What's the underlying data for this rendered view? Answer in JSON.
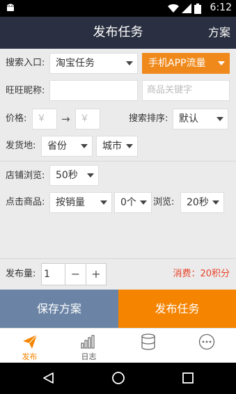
{
  "status_bar": {
    "time": "6:12"
  },
  "header": {
    "title": "发布任务",
    "action": "方案"
  },
  "form": {
    "search_entry_label": "搜索入口:",
    "search_entry_value": "淘宝任务",
    "traffic_type_value": "手机APP流量",
    "wangwang_label": "旺旺昵称:",
    "wangwang_value": "",
    "keyword_placeholder": "商品关键字",
    "price_label": "价格:",
    "price_min_placeholder": "￥",
    "price_arrow": "→",
    "price_max_placeholder": "￥",
    "sort_label": "搜索排序:",
    "sort_value": "默认",
    "ship_from_label": "发货地:",
    "province_value": "省份",
    "city_value": "城市",
    "shop_browse_label": "店铺浏览:",
    "shop_browse_value": "50秒",
    "click_goods_label": "点击商品:",
    "click_goods_value": "按销量",
    "click_count_value": "0个",
    "browse_label": "浏览:",
    "browse_value": "20秒",
    "quantity_label": "发布量:",
    "quantity_value": "1",
    "minus": "−",
    "plus": "+",
    "cost_text": "消费：20积分"
  },
  "buttons": {
    "save": "保存方案",
    "publish": "发布任务"
  },
  "tabs": [
    {
      "label": "发布",
      "icon": "paper-plane-icon",
      "active": true
    },
    {
      "label": "日志",
      "icon": "bar-chart-icon",
      "active": false
    },
    {
      "label": "",
      "icon": "database-icon",
      "active": false
    },
    {
      "label": "",
      "icon": "more-icon",
      "active": false
    }
  ],
  "colors": {
    "accent": "#f58400",
    "header_bg": "#2a3041",
    "save_bg": "#6b84a5"
  }
}
